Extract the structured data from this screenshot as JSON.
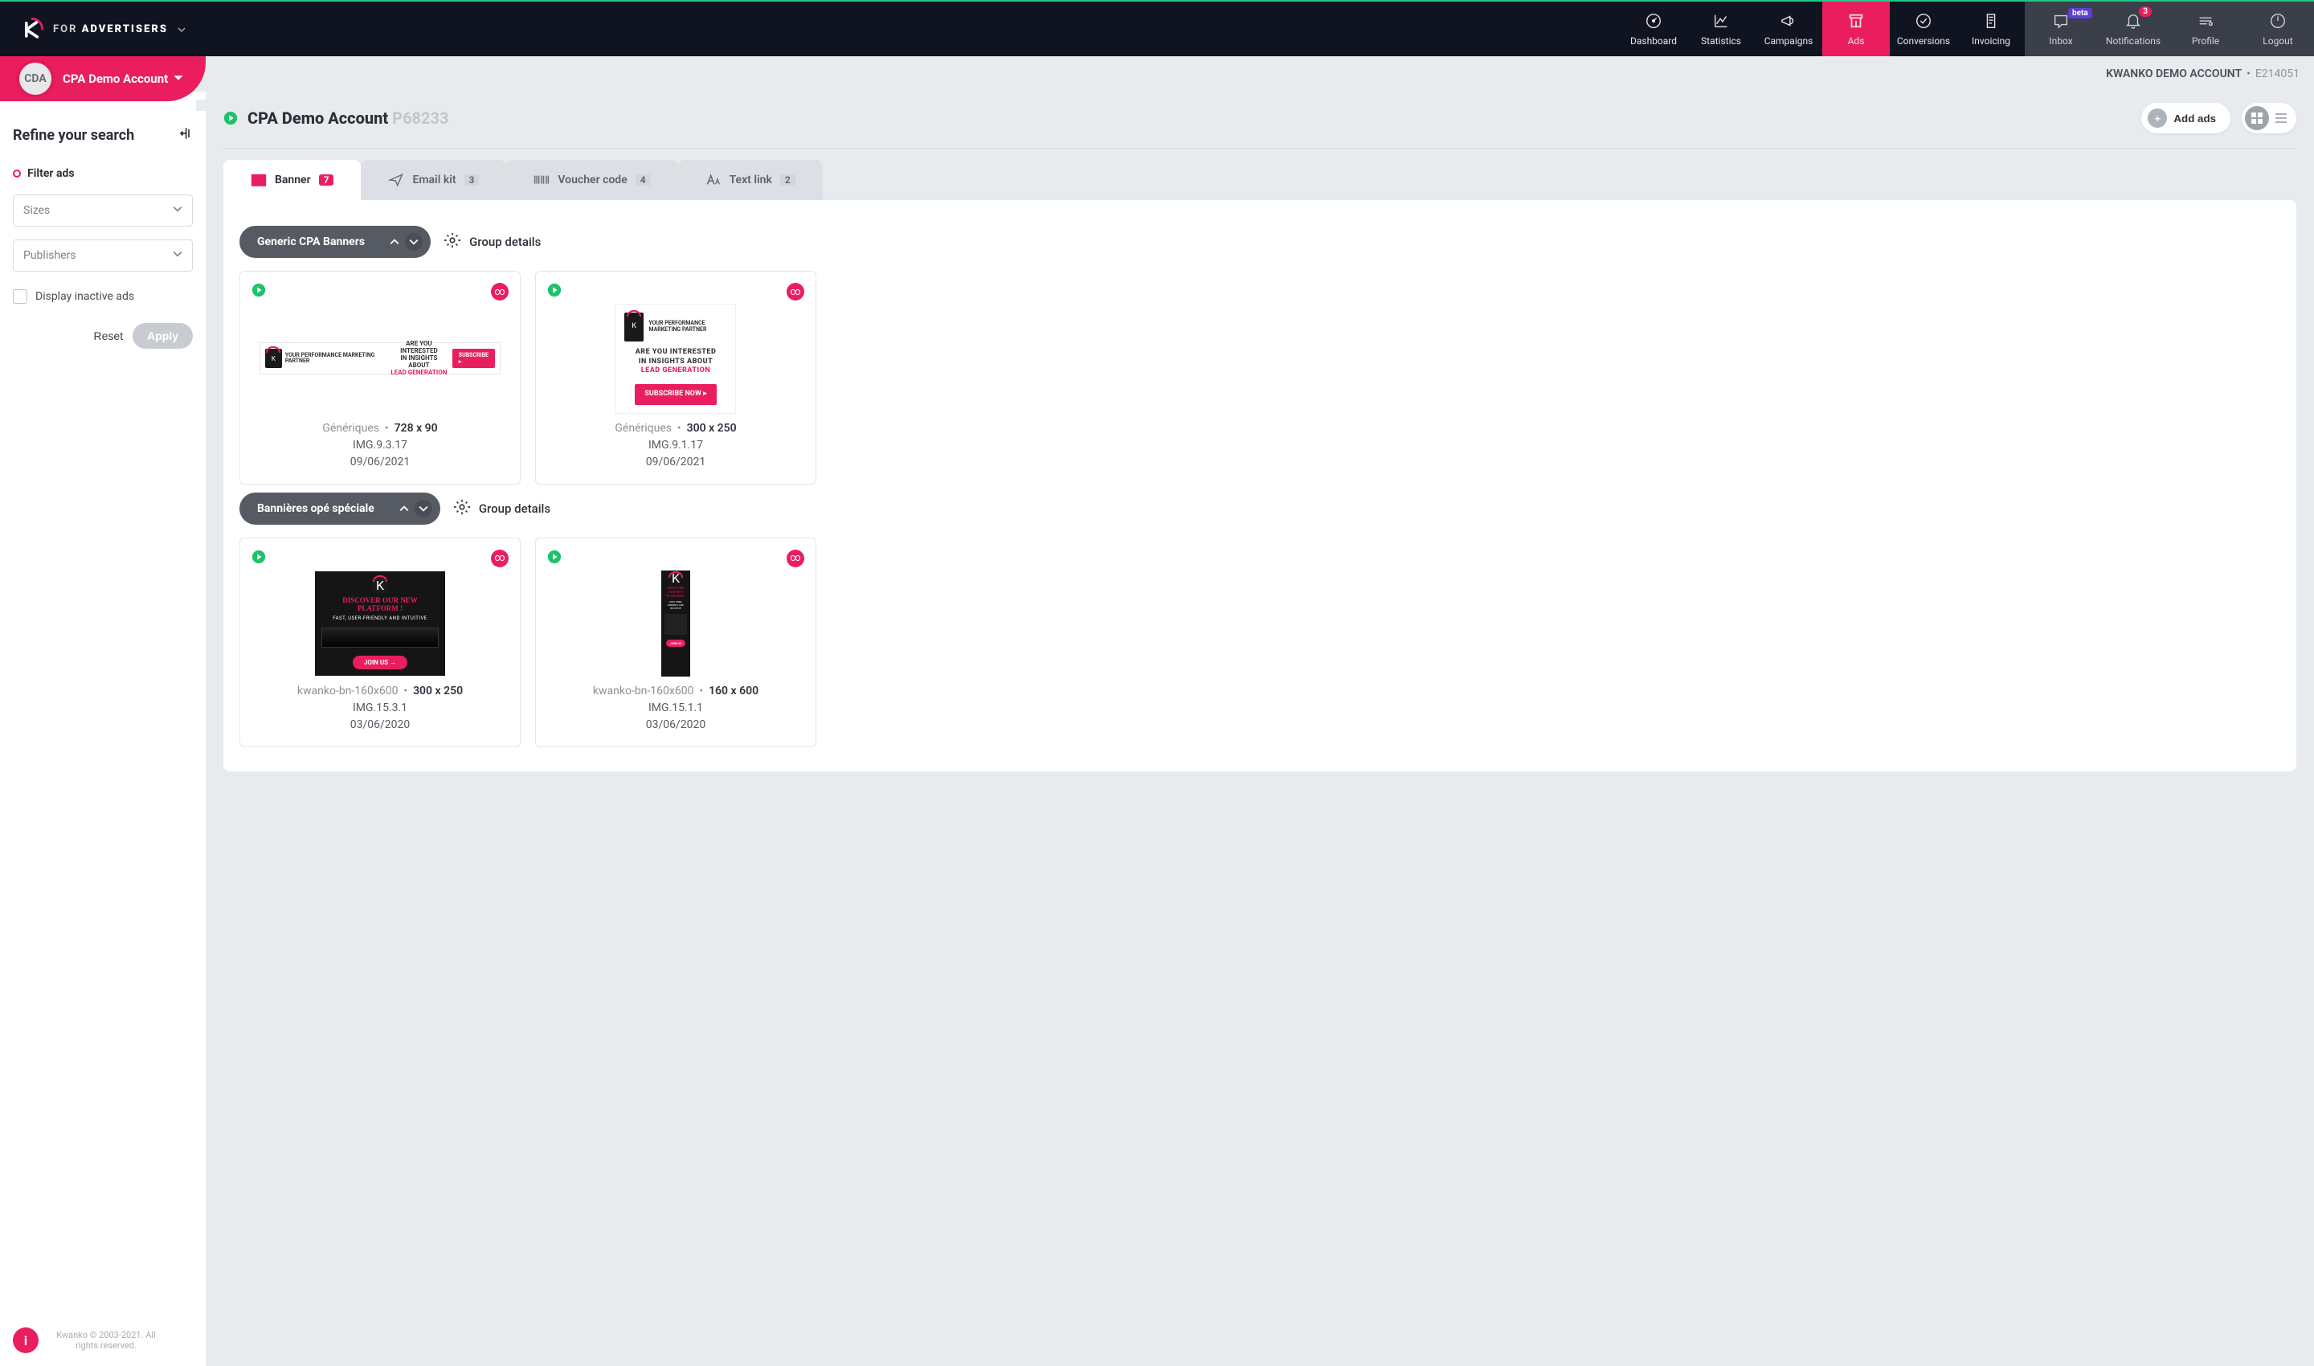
{
  "brand": {
    "for": "FOR",
    "role": "ADVERTISERS"
  },
  "nav": {
    "dashboard": "Dashboard",
    "statistics": "Statistics",
    "campaigns": "Campaigns",
    "ads": "Ads",
    "conversions": "Conversions",
    "invoicing": "Invoicing",
    "inbox": "Inbox",
    "inbox_badge": "beta",
    "notifications": "Notifications",
    "notifications_count": "3",
    "profile": "Profile",
    "logout": "Logout"
  },
  "account_header": {
    "name": "KWANKO DEMO ACCOUNT",
    "id": "E214051"
  },
  "sidebar": {
    "avatar": "CDA",
    "name": "CPA Demo Account",
    "refine": "Refine your search",
    "filter": "Filter ads",
    "sizes": "Sizes",
    "publishers": "Publishers",
    "inactive": "Display inactive ads",
    "reset": "Reset",
    "apply": "Apply",
    "copyright": "Kwanko © 2003-2021. All rights reserved."
  },
  "page": {
    "title": "CPA Demo Account",
    "code": "P68233",
    "add_ads": "Add ads"
  },
  "tabs": {
    "banner": {
      "label": "Banner",
      "count": "7"
    },
    "email": {
      "label": "Email kit",
      "count": "3"
    },
    "voucher": {
      "label": "Voucher code",
      "count": "4"
    },
    "textlink": {
      "label": "Text link",
      "count": "2"
    }
  },
  "groups": [
    {
      "name": "Generic CPA Banners",
      "details_label": "Group details",
      "cards": [
        {
          "category": "Génériques",
          "size": "728 x 90",
          "ref": "IMG.9.3.17",
          "date": "09/06/2021",
          "preview": {
            "type": "bn728",
            "line1": "ARE YOU INTERESTED",
            "line2": "IN INSIGHTS ABOUT",
            "line3": "LEAD GENERATION",
            "cta": "SUBSCRIBE",
            "partner": "YOUR PERFORMANCE MARKETING PARTNER"
          }
        },
        {
          "category": "Génériques",
          "size": "300 x 250",
          "ref": "IMG.9.1.17",
          "date": "09/06/2021",
          "preview": {
            "type": "bn300",
            "line1": "ARE YOU INTERESTED",
            "line2": "IN INSIGHTS ABOUT",
            "line3": "LEAD GENERATION",
            "cta": "SUBSCRIBE NOW",
            "partner": "YOUR PERFORMANCE MARKETING PARTNER"
          }
        }
      ]
    },
    {
      "name": "Bannières opé spéciale",
      "details_label": "Group details",
      "cards": [
        {
          "category": "kwanko-bn-160x600",
          "size": "300 x 250",
          "ref": "IMG.15.3.1",
          "date": "03/06/2020",
          "preview": {
            "type": "bn-disc",
            "headline": "DISCOVER OUR NEW PLATFORM !",
            "sub": "FAST, USER-FRIENDLY AND INTUITIVE",
            "cta": "JOIN US"
          }
        },
        {
          "category": "kwanko-bn-160x600",
          "size": "160 x 600",
          "ref": "IMG.15.1.1",
          "date": "03/06/2020",
          "preview": {
            "type": "bn-disc-sky",
            "headline": "DISCOVER OUR NEW PLATFORM !",
            "sub": "FAST, USER-FRIENDLY AND INTUITIVE",
            "cta": "JOIN US"
          }
        }
      ]
    }
  ]
}
